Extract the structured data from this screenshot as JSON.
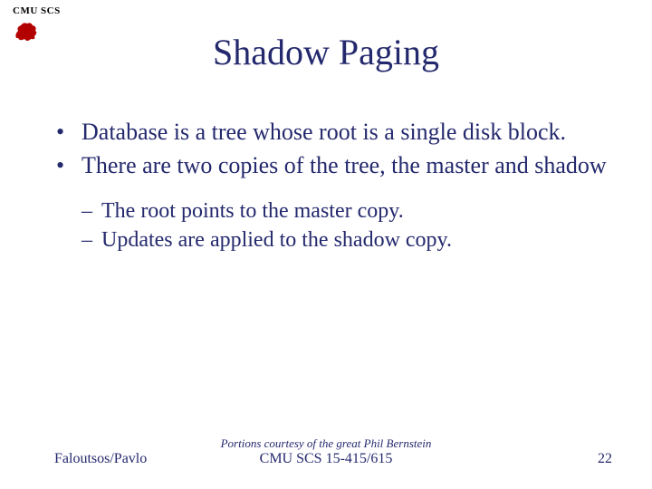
{
  "header": {
    "label": "CMU SCS",
    "icon": "dragon-icon"
  },
  "title": "Shadow Paging",
  "bullets": [
    "Database is a tree whose root is a single disk block.",
    "There are two copies of the tree, the master and shadow"
  ],
  "sub_bullets": [
    "The root points to the master copy.",
    "Updates are applied to the shadow copy."
  ],
  "footer": {
    "left": "Faloutsos/Pavlo",
    "credit": "Portions courtesy of the great Phil Bernstein",
    "course": "CMU SCS 15-415/615",
    "page": "22"
  },
  "colors": {
    "text": "#24296d",
    "dragon": "#b30000"
  }
}
